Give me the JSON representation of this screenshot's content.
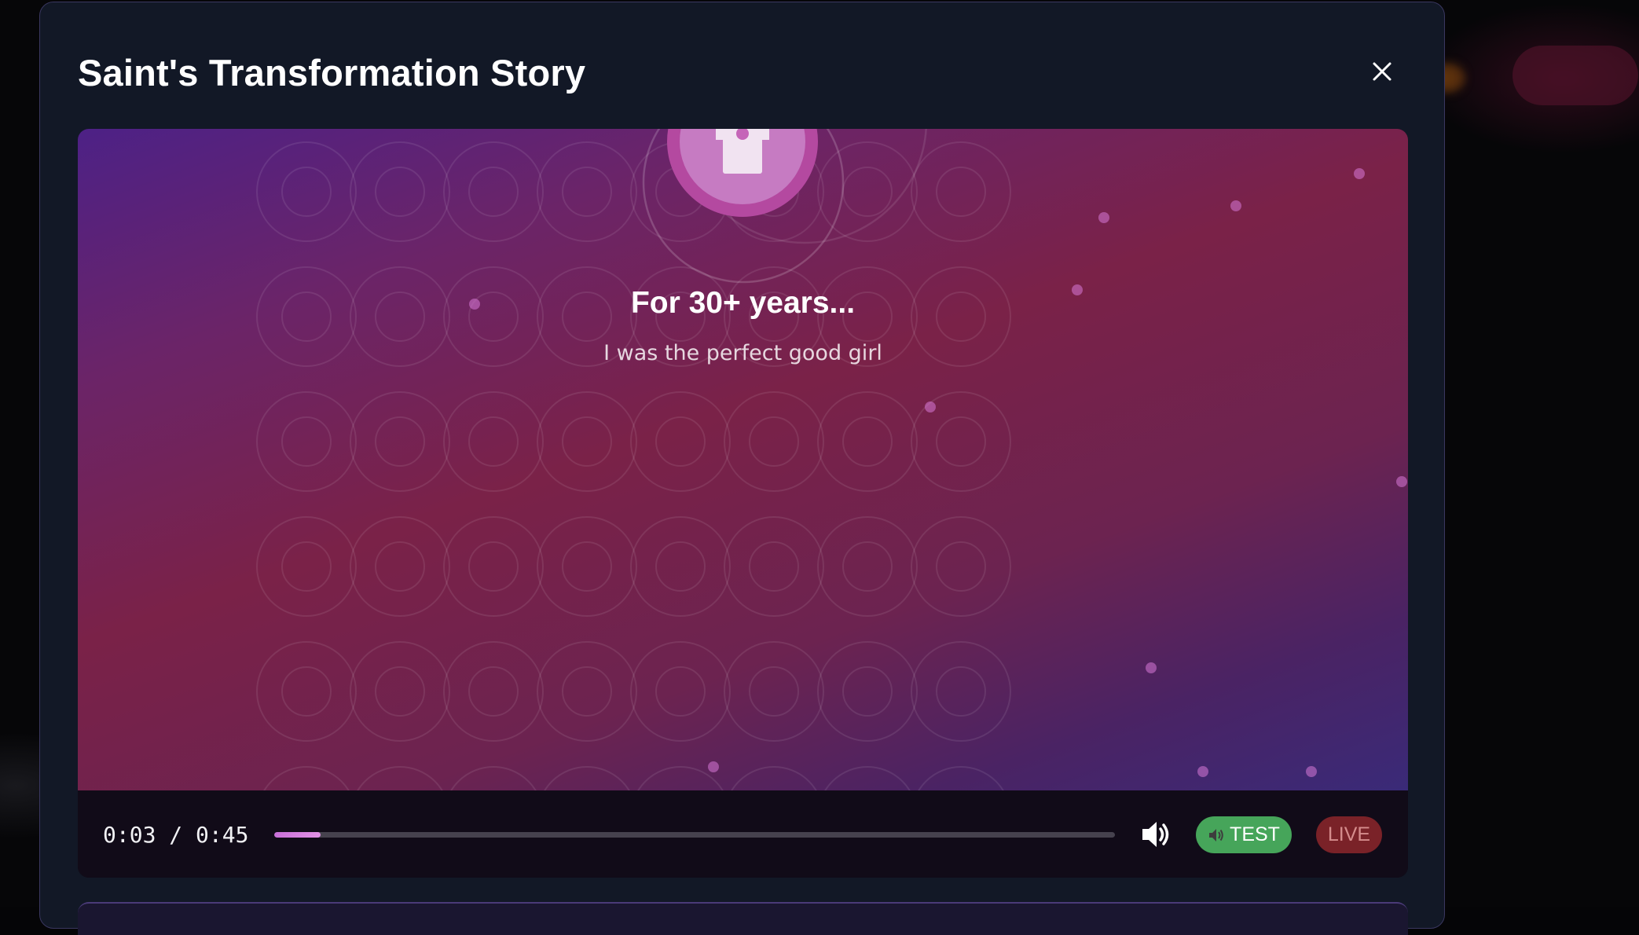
{
  "modal": {
    "title": "Saint's Transformation Story",
    "close_icon": "close-icon"
  },
  "slide": {
    "title": "For 30+ years...",
    "subtitle": "I was the perfect good girl",
    "icon": "shirt-icon"
  },
  "player": {
    "time_display": "0:03 / 0:45",
    "current_time": "0:03",
    "duration": "0:45",
    "progress_percent": 5.5,
    "volume_icon": "volume-icon",
    "test_button_label": "TEST",
    "test_button_icon": "speaker-icon",
    "live_button_label": "LIVE"
  },
  "colors": {
    "accent": "#c86fd8",
    "test": "#46a55a",
    "live": "#7a2228",
    "modal_bg": "#121826"
  }
}
